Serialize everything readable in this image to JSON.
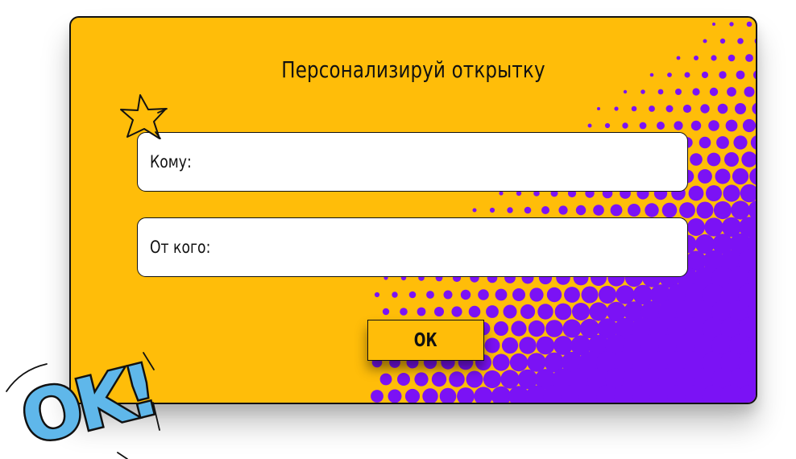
{
  "dialog": {
    "title": "Персонализируй открытку",
    "fields": {
      "to_label": "Кому:",
      "from_label": "От кого:"
    },
    "ok_label": "ОК"
  },
  "decor": {
    "sticker_text": "OK!",
    "colors": {
      "background": "#ffbd09",
      "halftone": "#7b12f5",
      "sticker_blue": "#5fb7ea",
      "star": "#ffbd09"
    }
  }
}
